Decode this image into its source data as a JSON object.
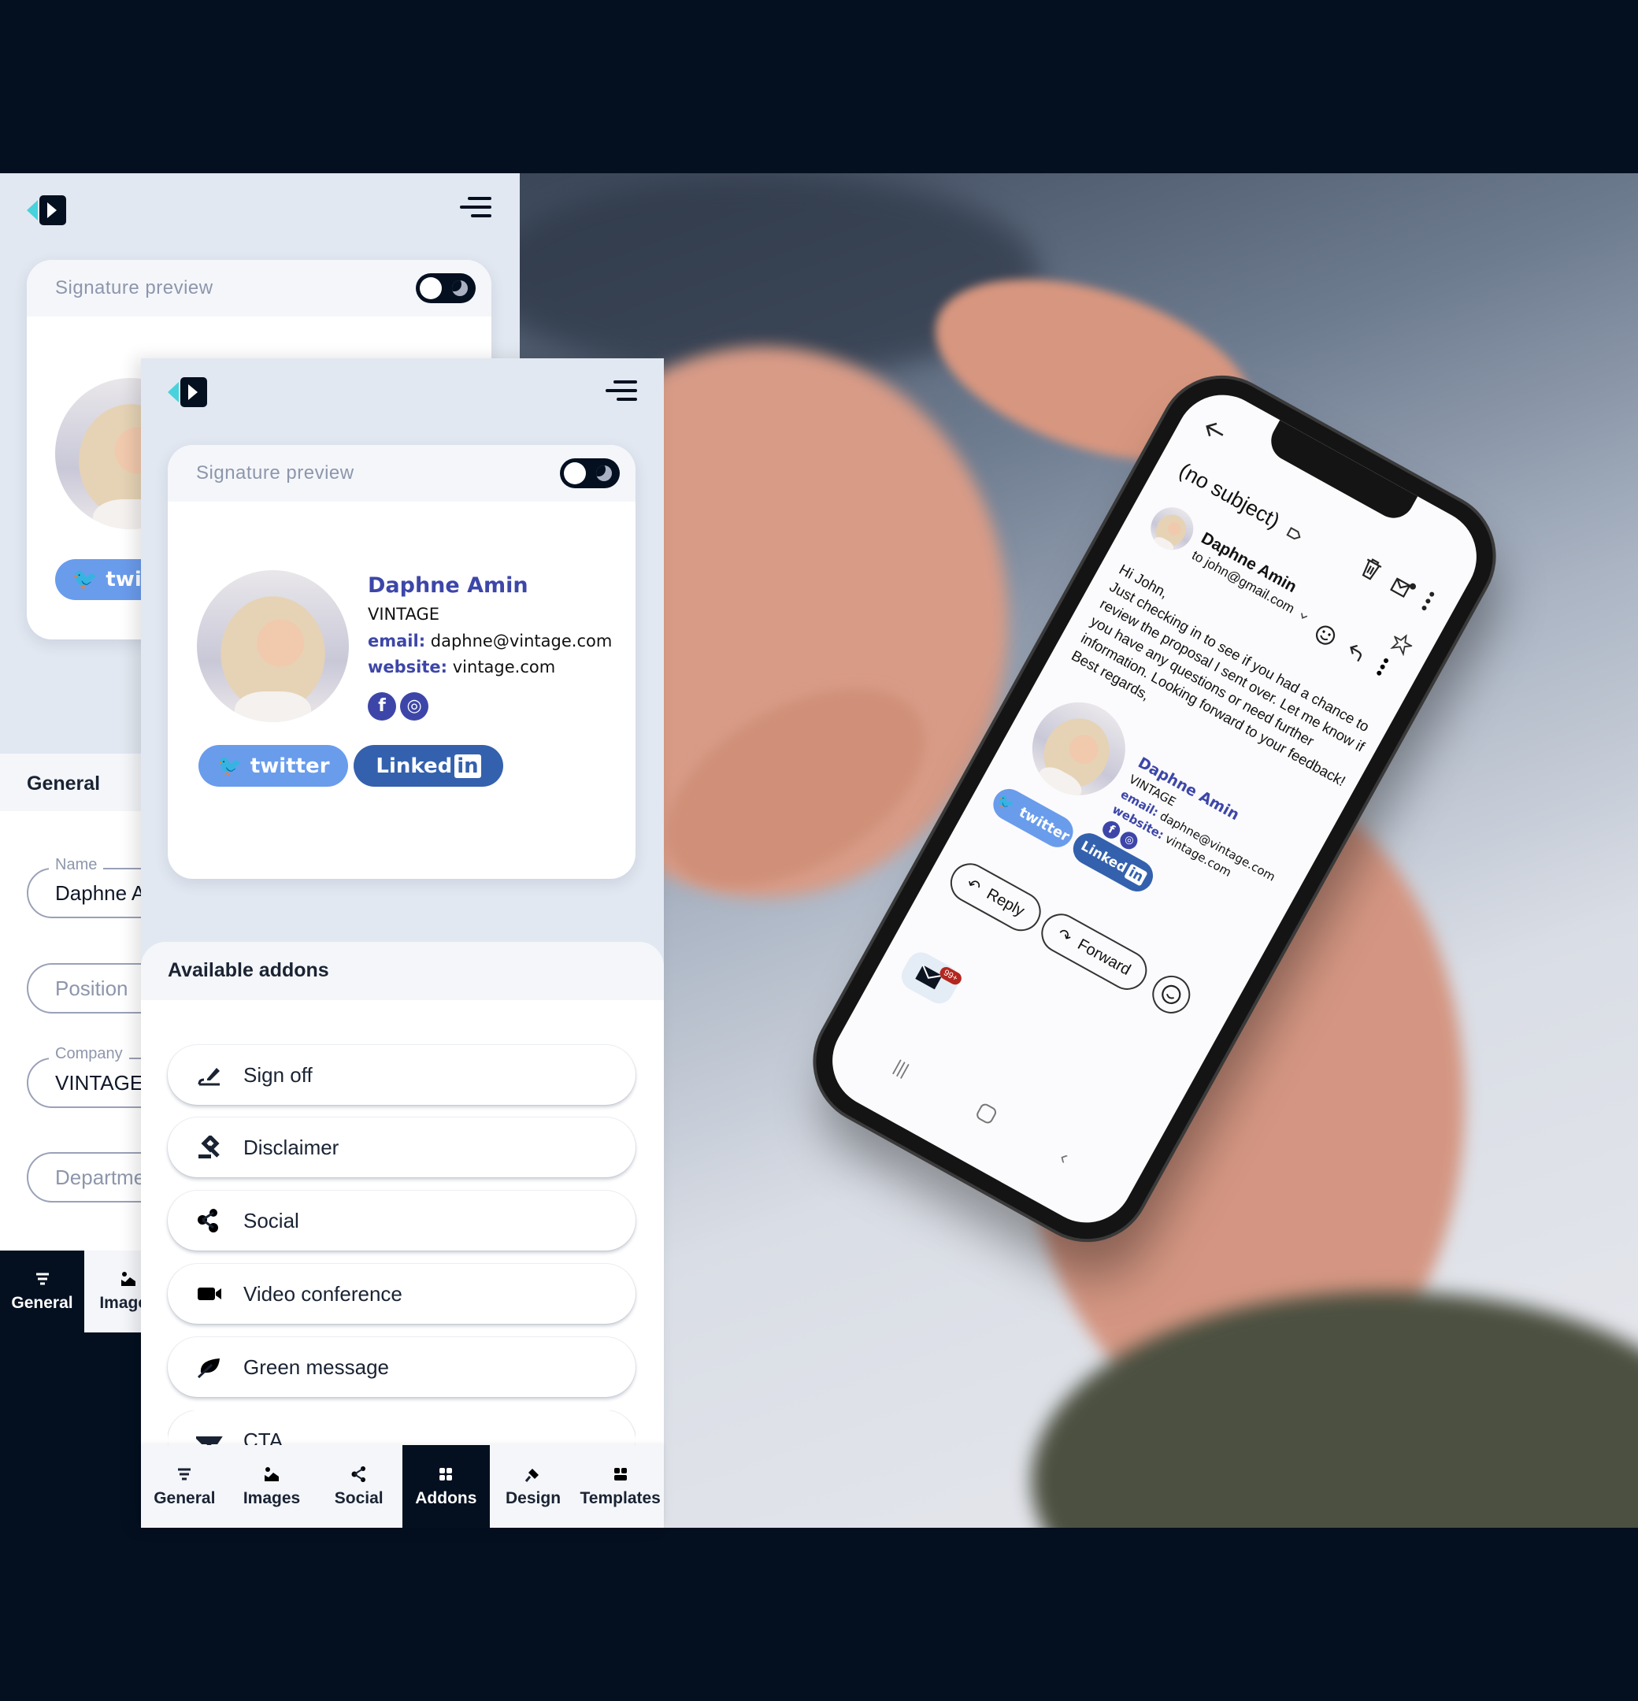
{
  "back_panel": {
    "signature_preview_title": "Signature preview",
    "twitter_label": "twi",
    "section_title": "General",
    "fields": [
      {
        "label": "Name",
        "value": "Daphne Amin"
      },
      {
        "label": "",
        "placeholder": "Position"
      },
      {
        "label": "Company",
        "value": "VINTAGE"
      },
      {
        "label": "",
        "placeholder": "Department"
      }
    ],
    "tabs": [
      {
        "label": "General",
        "icon": "list-icon",
        "active": true
      },
      {
        "label": "Images",
        "icon": "image-icon",
        "active": false
      }
    ]
  },
  "front_panel": {
    "signature_preview_title": "Signature preview",
    "signature": {
      "name": "Daphne Amin",
      "company": "VINTAGE",
      "email_label": "email:",
      "email": "daphne@vintage.com",
      "website_label": "website:",
      "website": "vintage.com",
      "social_icons": [
        "facebook-icon",
        "instagram-icon"
      ],
      "twitter_button": "twitter",
      "linkedin_button": "Linked",
      "linkedin_badge": "in"
    },
    "addons_title": "Available addons",
    "addons": [
      {
        "label": "Sign off",
        "icon": "signature-icon"
      },
      {
        "label": "Disclaimer",
        "icon": "gavel-icon"
      },
      {
        "label": "Social",
        "icon": "share-icon"
      },
      {
        "label": "Video conference",
        "icon": "video-icon"
      },
      {
        "label": "Green message",
        "icon": "leaf-icon"
      },
      {
        "label": "CTA",
        "icon": "cta-icon"
      }
    ],
    "tabs": [
      {
        "label": "General",
        "icon": "list-icon",
        "active": false
      },
      {
        "label": "Images",
        "icon": "image-icon",
        "active": false
      },
      {
        "label": "Social",
        "icon": "share-icon",
        "active": false
      },
      {
        "label": "Addons",
        "icon": "grid-icon",
        "active": true
      },
      {
        "label": "Design",
        "icon": "brush-icon",
        "active": false
      },
      {
        "label": "Templates",
        "icon": "templates-icon",
        "active": false
      }
    ]
  },
  "phone_email": {
    "subject": "(no subject)",
    "sender": "Daphne Amin",
    "recipient": "to john@gmail.com",
    "body": [
      "Hi John,",
      "Just checking in to see if you had a chance to",
      "review the proposal I sent over. Let me know if",
      "you have any questions or need further",
      "information. Looking forward to your feedback!",
      "Best regards,"
    ],
    "signature": {
      "name": "Daphne Amin",
      "company": "VINTAGE",
      "email_label": "email:",
      "email": "daphne@vintage.com",
      "website_label": "website:",
      "website": "vintage.com",
      "twitter_button": "twitter",
      "linkedin_button": "Linked",
      "linkedin_badge": "in"
    },
    "reply_button": "Reply",
    "forward_button": "Forward",
    "unread_badge": "99+"
  },
  "colors": {
    "background_dark": "#041020",
    "panel": "#e2e8f1",
    "accent_cyan": "#48d2dc",
    "signature_blue": "#3d46a8",
    "twitter": "#6a9cec",
    "linkedin": "#3461ad",
    "badge_red": "#b3261e"
  }
}
